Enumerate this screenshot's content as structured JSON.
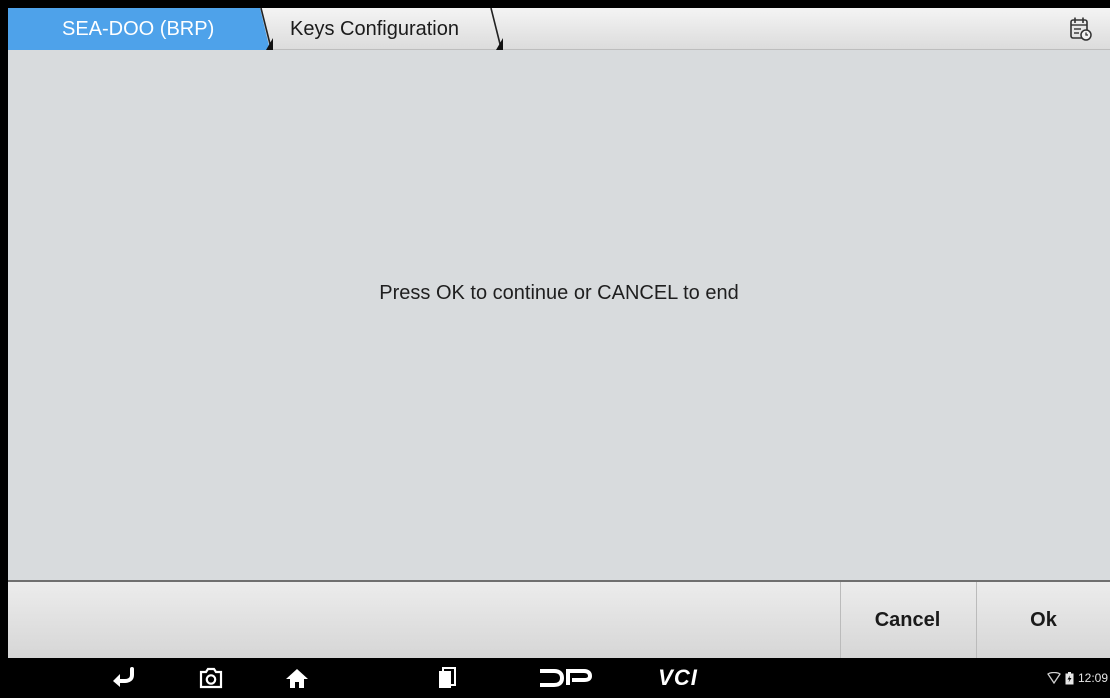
{
  "breadcrumb": {
    "items": [
      {
        "label": "SEA-DOO (BRP)"
      },
      {
        "label": "Keys Configuration"
      }
    ]
  },
  "icons": {
    "top_right": "calendar-clock-icon",
    "nav": [
      "back-icon",
      "camera-icon",
      "home-icon",
      "recent-apps-icon",
      "dp-logo-icon",
      "vci-icon"
    ],
    "status": [
      "wifi-icon",
      "battery-icon"
    ]
  },
  "main": {
    "message": "Press OK to continue or CANCEL to end"
  },
  "actions": {
    "cancel_label": "Cancel",
    "ok_label": "Ok"
  },
  "navbar": {
    "vci_label": "VCI"
  },
  "status": {
    "time": "12:09"
  },
  "colors": {
    "accent": "#4ea2ea",
    "content_bg": "#d8dbdd",
    "bar_bg": "#e4e4e4",
    "nav_bg": "#000000"
  }
}
